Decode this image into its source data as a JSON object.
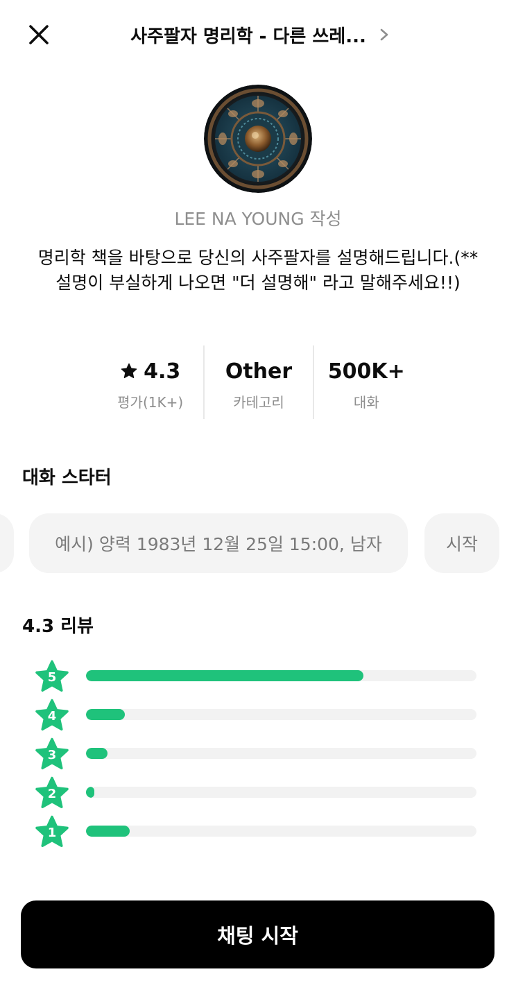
{
  "header": {
    "title": "사주팔자 명리학 - 다른 쓰레..."
  },
  "profile": {
    "author": "LEE NA YOUNG 작성",
    "description": "명리학 책을 바탕으로 당신의 사주팔자를 설명해드립니다.(**설명이 부실하게 나오면 \"더 설명해\" 라고 말해주세요!!)"
  },
  "stats": {
    "rating_value": "4.3",
    "rating_label": "평가(1K+)",
    "category_value": "Other",
    "category_label": "카테고리",
    "conversations_value": "500K+",
    "conversations_label": "대화"
  },
  "starters": {
    "title": "대화 스타터",
    "items": [
      "예시) 양력 1983년 12월 25일 15:00, 남자",
      "시작"
    ]
  },
  "reviews": {
    "title": "4.3 리뷰",
    "distribution": [
      {
        "stars": "5",
        "fraction": 0.71
      },
      {
        "stars": "4",
        "fraction": 0.1
      },
      {
        "stars": "3",
        "fraction": 0.055
      },
      {
        "stars": "2",
        "fraction": 0.022
      },
      {
        "stars": "1",
        "fraction": 0.112
      }
    ]
  },
  "footer": {
    "cta_label": "채팅 시작"
  },
  "colors": {
    "accent": "#1fc27b",
    "track": "#f2f2f2",
    "chip_bg": "#f4f4f4",
    "muted_text": "#8e8e8e",
    "cta_bg": "#000000"
  },
  "icons": {
    "close": "close-icon",
    "chevron": "chevron-right-icon",
    "rating": "star-icon",
    "badge": "star-badge-icon"
  }
}
